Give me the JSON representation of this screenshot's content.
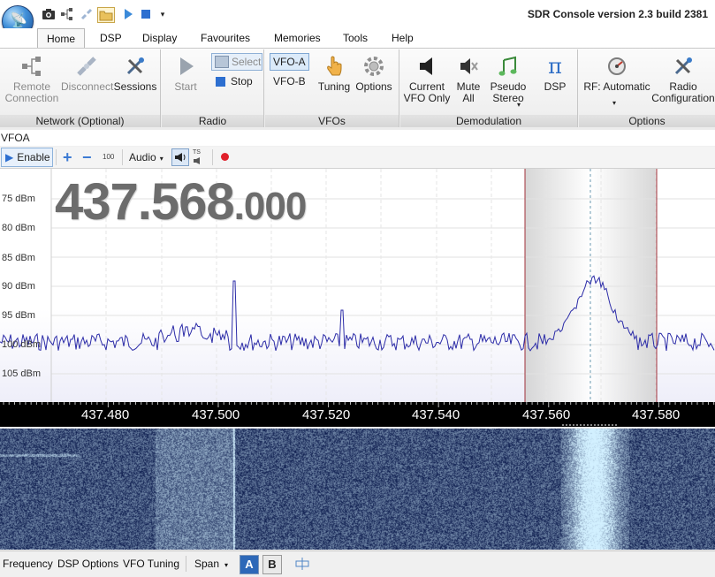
{
  "window": {
    "title": "SDR Console version 2.3 build 2381",
    "quick_access_icons": [
      "camera-icon",
      "network-icon",
      "disconnect-icon",
      "folder-icon",
      "play-icon",
      "stop-icon",
      "dropdown-icon"
    ]
  },
  "ribbon": {
    "tabs": [
      "Home",
      "DSP",
      "Display",
      "Favourites",
      "Memories",
      "Tools",
      "Help"
    ],
    "active_tab": "Home",
    "groups": {
      "network": {
        "label": "Network (Optional)",
        "remote_connection": "Remote\nConnection",
        "disconnect": "Disconnect",
        "sessions": "Sessions"
      },
      "radio": {
        "label": "Radio",
        "start": "Start",
        "select": "Select",
        "stop": "Stop"
      },
      "vfos": {
        "label": "VFOs",
        "vfo_a": "VFO-A",
        "vfo_b": "VFO-B",
        "tuning": "Tuning",
        "options": "Options"
      },
      "demodulation": {
        "label": "Demodulation",
        "current_vfo_only": "Current\nVFO Only",
        "mute_all": "Mute\nAll",
        "pseudo_stereo": "Pseudo\nStereo",
        "dsp": "DSP"
      },
      "options": {
        "label": "Options",
        "rf_automatic": "RF: Automatic",
        "radio_configuration": "Radio\nConfiguration"
      }
    }
  },
  "vfo_panel": {
    "header": "VFOA",
    "enable": "Enable",
    "zoom_value": "100",
    "audio": "Audio",
    "ts_label": "TS",
    "frequency_main": "437.568",
    "frequency_fraction": ".000",
    "dbm_labels": [
      "75 dBm",
      "80 dBm",
      "85 dBm",
      "90 dBm",
      "95 dBm",
      "100 dBm",
      "105 dBm"
    ],
    "ruler_labels": [
      "437.480",
      "437.500",
      "437.520",
      "437.540",
      "437.560",
      "437.580"
    ]
  },
  "statusbar": {
    "frequency": "Frequency",
    "dsp_options": "DSP Options",
    "vfo_tuning": "VFO Tuning",
    "span": "Span",
    "a": "A",
    "b": "B"
  },
  "colors": {
    "trace": "#2c2ca8",
    "filter_edge": "#a0303a",
    "waterfall_bg": "#0b1a4c",
    "ribbon_active_tab": "#ffffff"
  }
}
